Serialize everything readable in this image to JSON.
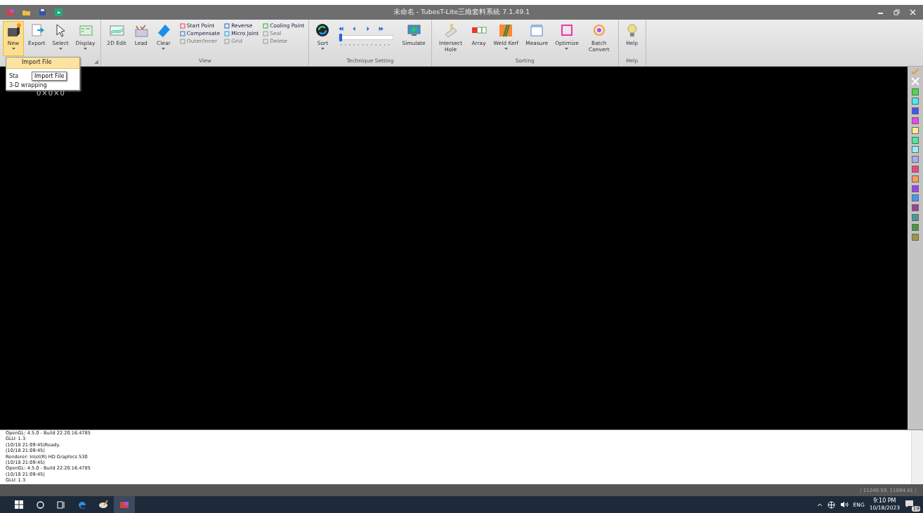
{
  "window": {
    "title": "未命名 - TubesT-Lite三維套料系統 7.1.49.1"
  },
  "ribbon": {
    "groups": [
      {
        "launcher": true,
        "buttons": [
          {
            "label": "New",
            "selected": true,
            "caret": true
          },
          {
            "label": "Export",
            "selected": false
          },
          {
            "label": "Select",
            "selected": false,
            "caret": true
          },
          {
            "label": "Display",
            "selected": false,
            "caret": true
          }
        ]
      },
      {
        "label": "View",
        "buttons": [
          {
            "label": "2D Edit",
            "selected": false
          },
          {
            "label": "Lead",
            "selected": false
          },
          {
            "label": "Clear",
            "selected": false,
            "caret": true
          }
        ],
        "small_buttons": [
          {
            "label": "Start Point",
            "disabled": false
          },
          {
            "label": "Reverse",
            "disabled": false
          },
          {
            "label": "Cooling Point",
            "disabled": false
          },
          {
            "label": "Compensate",
            "disabled": false
          },
          {
            "label": "Micro Joint",
            "disabled": false
          },
          {
            "label": "Seal",
            "disabled": true
          },
          {
            "label": "Outer/Inner",
            "disabled": true
          },
          {
            "label": "Grid",
            "disabled": true
          },
          {
            "label": "Delete",
            "disabled": true
          }
        ]
      },
      {
        "label": "Technique Setting",
        "buttons": [
          {
            "label": "Sort",
            "selected": false,
            "caret": true
          }
        ],
        "player": {
          "level": 0.02
        },
        "buttons_after": [
          {
            "label": "Simulate",
            "selected": false
          }
        ]
      },
      {
        "label": "Sorting",
        "buttons": [
          {
            "label": "Intersect Hole",
            "selected": false,
            "caret": true
          },
          {
            "label": "Array",
            "selected": false
          },
          {
            "label": "Weld Kerf",
            "selected": false,
            "caret": true
          },
          {
            "label": "Measure",
            "selected": false
          },
          {
            "label": "Optimize",
            "selected": false,
            "caret": true
          },
          {
            "label": "Batch Convert",
            "selected": false
          }
        ]
      },
      {
        "label": "Help",
        "buttons": [
          {
            "label": "Help",
            "selected": false
          }
        ]
      }
    ]
  },
  "menu": {
    "items": [
      {
        "label": "Import File",
        "selected": true
      },
      {
        "label": "Sta",
        "selected": false
      },
      {
        "label": "3-D wrapping",
        "selected": false
      }
    ],
    "tooltip": "Import File"
  },
  "canvas": {
    "dimensions": "0×0×0"
  },
  "palette": [
    {
      "color": "#44dd44"
    },
    {
      "color": "#44eeee"
    },
    {
      "color": "#4455ee"
    },
    {
      "color": "#ee44ee"
    },
    {
      "color": "#ffee99"
    },
    {
      "color": "#44ee99"
    },
    {
      "color": "#99eeee"
    },
    {
      "color": "#aaaaee"
    },
    {
      "color": "#ee4488"
    },
    {
      "color": "#ff9966"
    },
    {
      "color": "#9944ee"
    },
    {
      "color": "#4499ee"
    },
    {
      "color": "#994499"
    },
    {
      "color": "#449999"
    },
    {
      "color": "#449944"
    },
    {
      "color": "#999944"
    }
  ],
  "log": [
    "OpenGL: 4.5.0 - Build 22.20.16.4785",
    "GLU: 1.3",
    "(10/18 21:09:45)Ready.",
    "(10/18 21:09:45)",
    "Renderer: Intel(R) HD Graphics 530",
    "(10/18 21:09:45)",
    "OpenGL: 4.5.0 - Build 22.20.16.4785",
    "(10/18 21:09:45)",
    "GLU: 1.3"
  ],
  "status_bar": {
    "coordinates": "11240.59, 11084.41"
  },
  "taskbar": {
    "apps": [
      {
        "selected": false
      },
      {
        "selected": false
      },
      {
        "selected": true
      }
    ],
    "language": "ENG",
    "time": "9:10 PM",
    "date": "10/18/2023",
    "notifications": "19"
  }
}
